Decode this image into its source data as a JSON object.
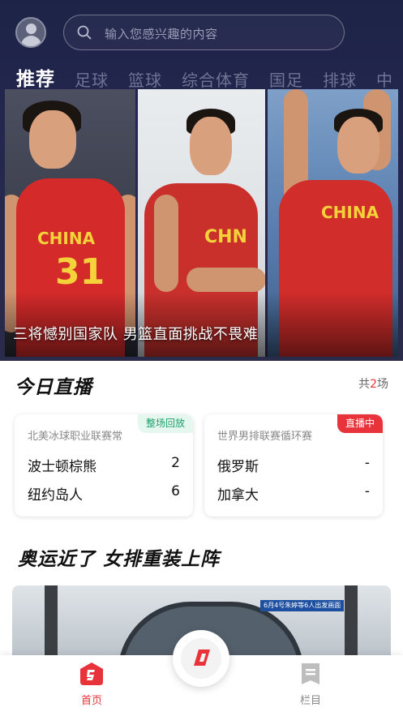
{
  "search": {
    "placeholder": "输入您感兴趣的内容",
    "icon": "search-icon"
  },
  "tabs": [
    {
      "label": "推荐",
      "active": true
    },
    {
      "label": "足球"
    },
    {
      "label": "篮球"
    },
    {
      "label": "综合体育"
    },
    {
      "label": "国足"
    },
    {
      "label": "排球"
    },
    {
      "label": "中"
    }
  ],
  "banner": {
    "caption": "三将憾别国家队 男篮直面挑战不畏难",
    "jersey_1": {
      "text": "CHINA",
      "number": "31"
    },
    "jersey_2": {
      "text": "CHN"
    },
    "jersey_3": {
      "text": "CHINA"
    },
    "active_slide": 1,
    "slide_count": 2
  },
  "live": {
    "title": "今日直播",
    "count_prefix": "共",
    "count": "2",
    "count_suffix": "场",
    "matches": [
      {
        "league": "北美冰球职业联赛常",
        "badge": "整场回放",
        "team_a": "波士顿棕熊",
        "score_a": "2",
        "team_b": "纽约岛人",
        "score_b": "6"
      },
      {
        "league": "世界男排联赛循环赛",
        "badge": "直播中",
        "team_a": "俄罗斯",
        "score_a": "-",
        "team_b": "加拿大",
        "score_b": "-"
      }
    ]
  },
  "article": {
    "title": "奥运近了 女排重装上阵",
    "image_tag": "6月4号朱婷等6人出发画面"
  },
  "nav": {
    "home_label": "首页",
    "column_label": "栏目"
  },
  "colors": {
    "accent_red": "#e8333a",
    "replay_green": "#1ca06b",
    "header_bg": "#1d2347"
  }
}
